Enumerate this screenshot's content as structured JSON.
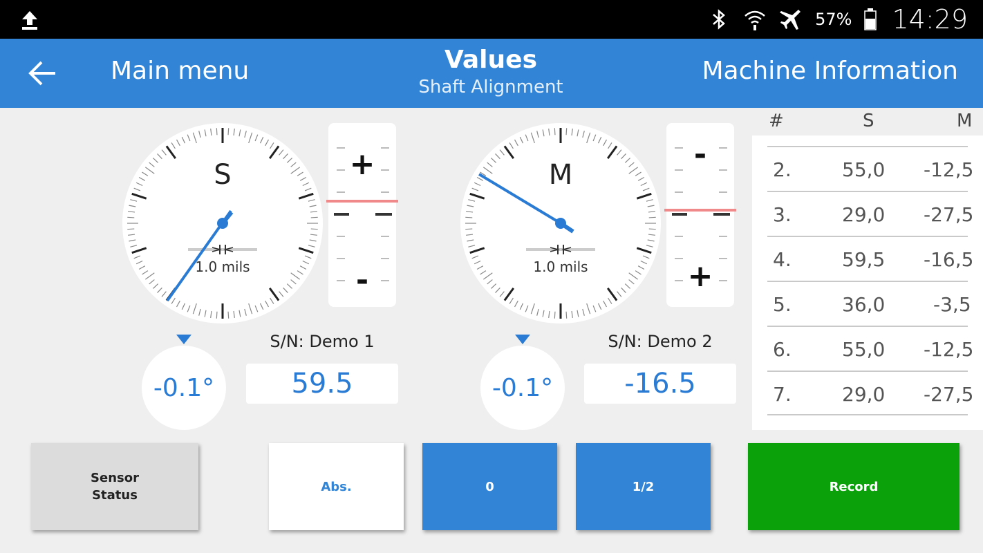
{
  "status_bar": {
    "battery_percent": "57%",
    "time": "14:29",
    "icons": [
      "upload-icon",
      "bluetooth-icon",
      "wifi-icon",
      "airplane-icon",
      "battery-icon"
    ]
  },
  "app_bar": {
    "back_label": "Main menu",
    "title": "Values",
    "subtitle": "Shaft Alignment",
    "right_label": "Machine Information"
  },
  "sensors": [
    {
      "dial_letter": "S",
      "scale": "1.0 mils",
      "inclination": "-0.1°",
      "serial": "S/N: Demo 1",
      "value": "59.5",
      "top_sign": "+",
      "bottom_sign": "-"
    },
    {
      "dial_letter": "M",
      "scale": "1.0 mils",
      "inclination": "-0.1°",
      "serial": "S/N: Demo 2",
      "value": "-16.5",
      "top_sign": "-",
      "bottom_sign": "+"
    }
  ],
  "table": {
    "headers": [
      "#",
      "S",
      "M"
    ],
    "rows": [
      [
        "2.",
        "55,0",
        "-12,5"
      ],
      [
        "3.",
        "29,0",
        "-27,5"
      ],
      [
        "4.",
        "59,5",
        "-16,5"
      ],
      [
        "5.",
        "36,0",
        "-3,5"
      ],
      [
        "6.",
        "55,0",
        "-12,5"
      ],
      [
        "7.",
        "29,0",
        "-27,5"
      ]
    ]
  },
  "buttons": {
    "sensor_status": "Sensor\nStatus",
    "abs": "Abs.",
    "zero": "0",
    "half": "1/2",
    "record": "Record"
  },
  "colors": {
    "accent": "#3285d6",
    "record": "#0aa10a",
    "indicator_line": "#f08a8a",
    "value_text": "#2a7bd3"
  }
}
